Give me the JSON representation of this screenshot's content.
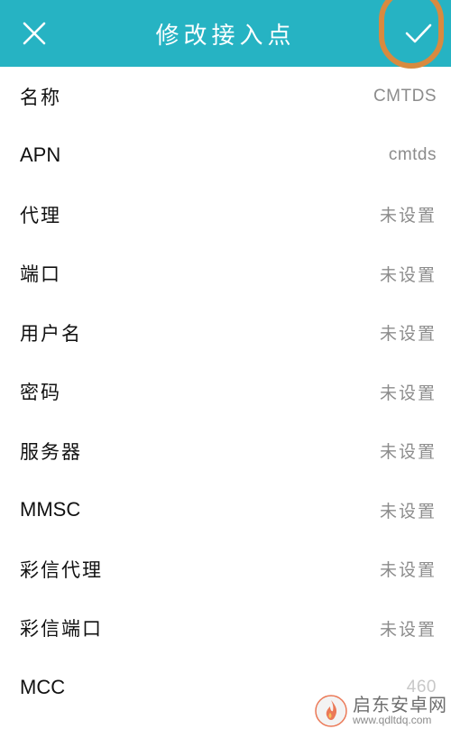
{
  "header": {
    "title": "修改接入点",
    "background_color": "#26b3c3",
    "close_icon": "close-icon",
    "confirm_icon": "checkmark-icon",
    "highlight_color": "#d88a3f"
  },
  "fields": [
    {
      "label": "名称",
      "value": "CMTDS"
    },
    {
      "label": "APN",
      "value": "cmtds"
    },
    {
      "label": "代理",
      "value": "未设置"
    },
    {
      "label": "端口",
      "value": "未设置"
    },
    {
      "label": "用户名",
      "value": "未设置"
    },
    {
      "label": "密码",
      "value": "未设置"
    },
    {
      "label": "服务器",
      "value": "未设置"
    },
    {
      "label": "MMSC",
      "value": "未设置"
    },
    {
      "label": "彩信代理",
      "value": "未设置"
    },
    {
      "label": "彩信端口",
      "value": "未设置"
    },
    {
      "label": "MCC",
      "value": "460"
    }
  ],
  "watermark": {
    "name": "启东安卓网",
    "url": "www.qdltdq.com",
    "icon": "flame-logo-icon"
  }
}
